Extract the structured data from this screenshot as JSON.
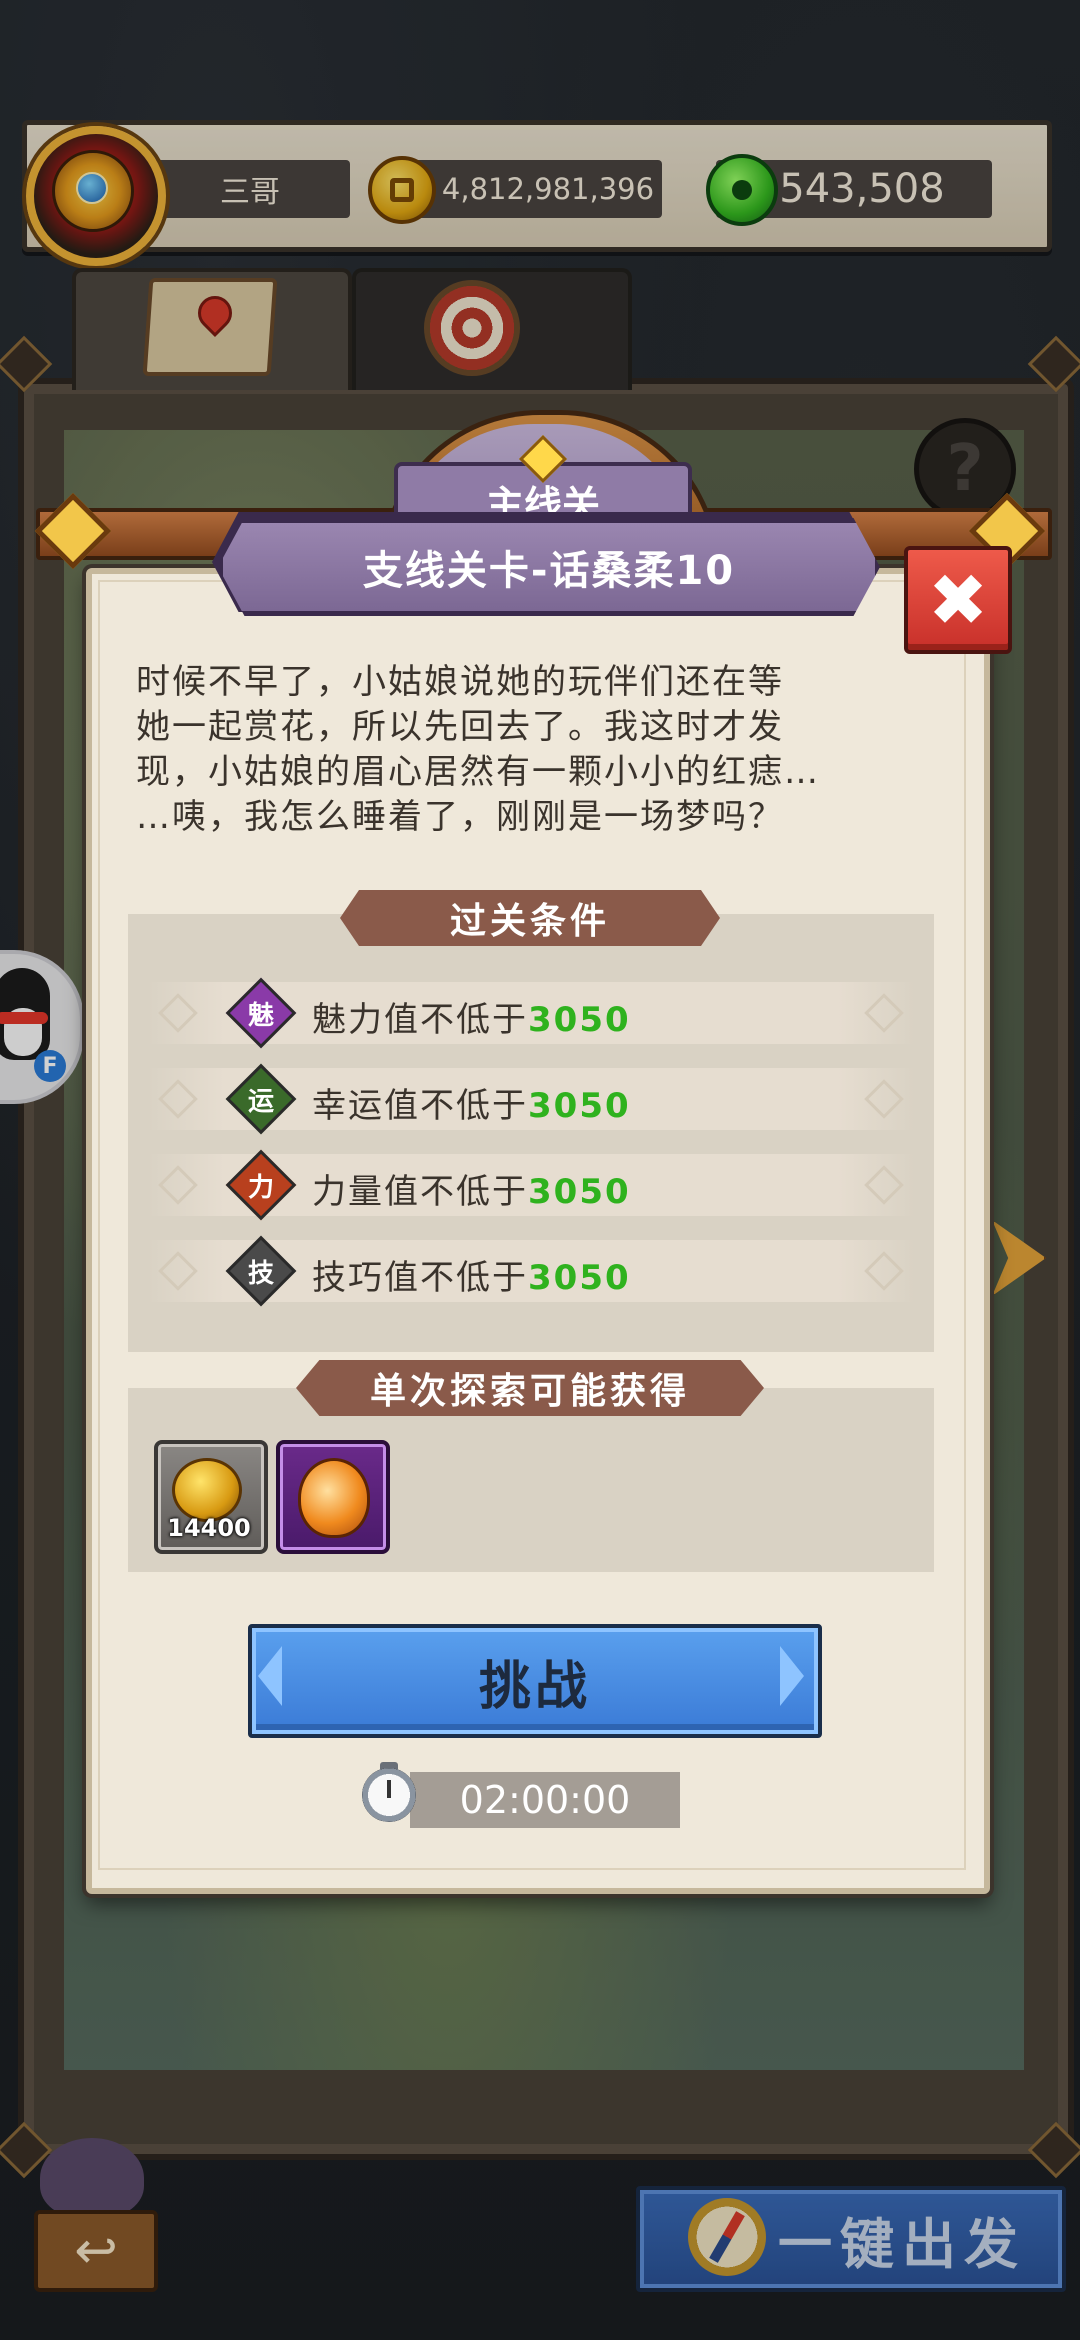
{
  "player": {
    "name": "三哥",
    "gold": "4,812,981,396",
    "jade": "543,508"
  },
  "tabs": [
    {
      "icon": "map-icon"
    },
    {
      "icon": "target-icon"
    }
  ],
  "dialog": {
    "category": "主线关",
    "title": "支线关卡-话桑柔10",
    "close_label": "✖",
    "story_lines": [
      "时候不早了，小姑娘说她的玩伴们还在等",
      "她一起赏花，所以先回去了。我这时才发",
      "现，小姑娘的眉心居然有一颗小小的红痣…",
      "…咦，我怎么睡着了，刚刚是一场梦吗？"
    ],
    "conditions_title": "过关条件",
    "conditions": [
      {
        "badge": "魅",
        "label": "魅力值不低于",
        "value": "3050",
        "color": "#8a3aa8"
      },
      {
        "badge": "运",
        "label": "幸运值不低于",
        "value": "3050",
        "color": "#3a6a2a"
      },
      {
        "badge": "力",
        "label": "力量值不低于",
        "value": "3050",
        "color": "#b8401e"
      },
      {
        "badge": "技",
        "label": "技巧值不低于",
        "value": "3050",
        "color": "#4a4a4a"
      }
    ],
    "rewards_title": "单次探索可能获得",
    "rewards": [
      {
        "icon": "gold-coin-icon",
        "count": "14400"
      },
      {
        "icon": "fire-egg-icon",
        "count": ""
      }
    ],
    "challenge_label": "挑战",
    "timer": "02:00:00"
  },
  "help_label": "?",
  "qq_label": "F",
  "back_label": "↩",
  "dispatch_label": "一键出发",
  "colors": {
    "accent_green": "#2fb21e",
    "challenge_blue": "#3a7ad6",
    "close_red": "#c8302a",
    "title_purple": "#7c6894"
  }
}
